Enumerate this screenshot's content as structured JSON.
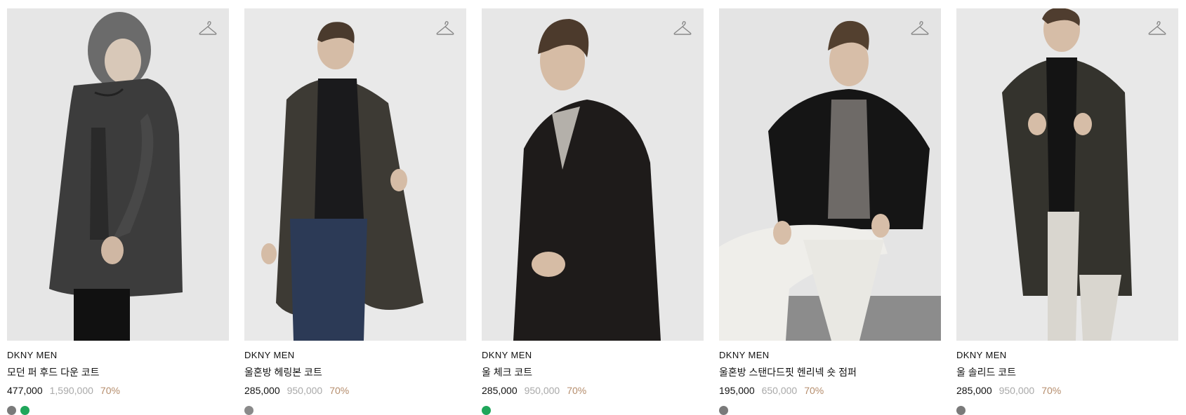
{
  "products": [
    {
      "brand": "DKNY MEN",
      "name": "모던 퍼 후드 다운 코트",
      "price": "477,000",
      "original_price": "1,590,000",
      "discount": "70%",
      "swatches": [
        "#7a7a7a",
        "#1fa65a"
      ],
      "icon": "hanger-icon"
    },
    {
      "brand": "DKNY MEN",
      "name": "울혼방 헤링본 코트",
      "price": "285,000",
      "original_price": "950,000",
      "discount": "70%",
      "swatches": [
        "#8a8a8a"
      ],
      "icon": "hanger-icon"
    },
    {
      "brand": "DKNY MEN",
      "name": "울 체크 코트",
      "price": "285,000",
      "original_price": "950,000",
      "discount": "70%",
      "swatches": [
        "#1fa65a"
      ],
      "icon": "hanger-icon"
    },
    {
      "brand": "DKNY MEN",
      "name": "울혼방 스탠다드핏 헨리넥 숏 점퍼",
      "price": "195,000",
      "original_price": "650,000",
      "discount": "70%",
      "swatches": [
        "#7a7a7a"
      ],
      "icon": "hanger-icon"
    },
    {
      "brand": "DKNY MEN",
      "name": "울 솔리드 코트",
      "price": "285,000",
      "original_price": "950,000",
      "discount": "70%",
      "swatches": [
        "#7a7a7a"
      ],
      "icon": "hanger-icon"
    }
  ],
  "colors": {
    "discount": "#b58d6c",
    "original_price": "#a9a9a9",
    "text": "#111111"
  }
}
